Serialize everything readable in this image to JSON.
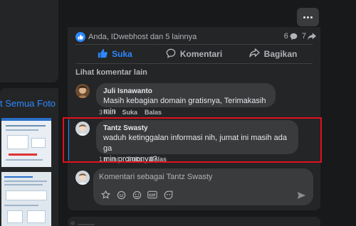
{
  "left": {
    "see_all_photos": "t Semua Foto"
  },
  "post": {
    "reaction_names": "Anda, IDwebhost dan 5 lainnya",
    "comment_count": "6",
    "share_count": "7",
    "actions": {
      "like": "Suka",
      "comment": "Komentari",
      "share": "Bagikan"
    },
    "view_more_comments": "Lihat komentar lain"
  },
  "comments": [
    {
      "name": "Juli Isnawanto",
      "text": "Masih kebagian domain gratisnya, Terimakasih min",
      "time": "3 hari",
      "like": "Suka",
      "reply": "Balas"
    },
    {
      "name": "Tantz Swasty",
      "text_line1": "waduh ketinggalan informasi nih, jumat ini masih ada ga",
      "text_line2": "min promonya?",
      "time": "1 menit",
      "like": "Suka",
      "reply": "Balas"
    }
  ],
  "composer": {
    "placeholder": "Komentari sebagai Tantz Swasty",
    "tool_icons": [
      "sticker-icon",
      "avatar-sticker-icon",
      "emoji-icon",
      "gif-icon",
      "sticker2-icon"
    ]
  },
  "colors": {
    "accent": "#2d88ff",
    "highlight": "#e0101d",
    "background": "#18191a",
    "card": "#242526",
    "bubble": "#3a3b3c"
  }
}
